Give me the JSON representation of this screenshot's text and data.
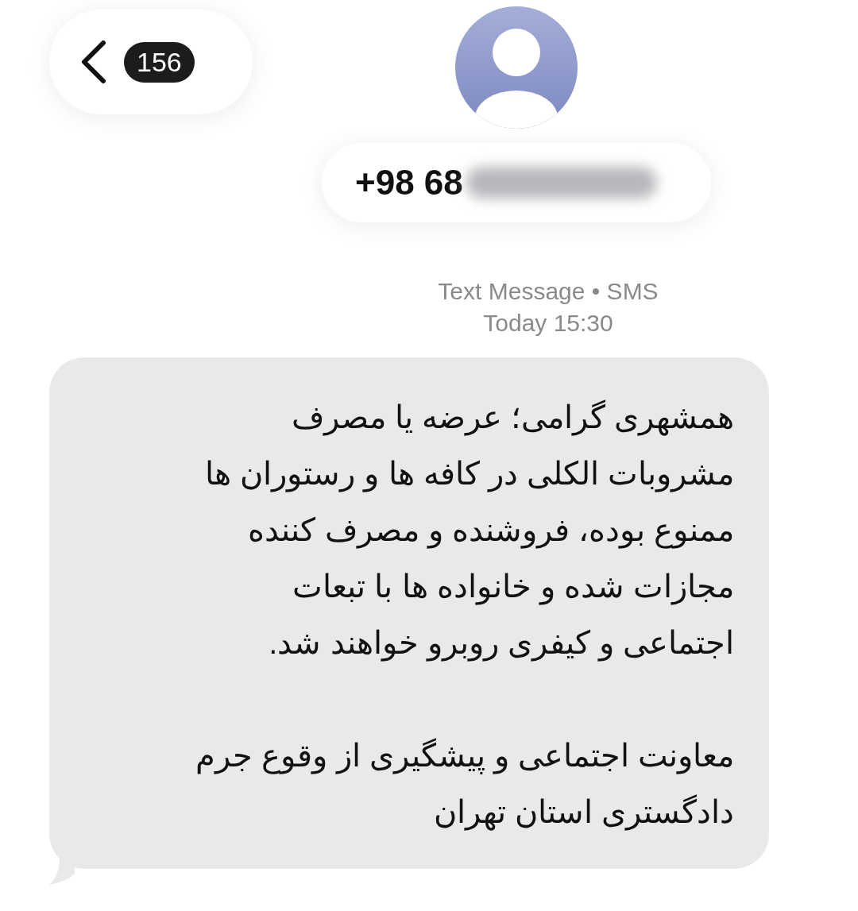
{
  "header": {
    "unread_count": "156",
    "sender": "+98 68"
  },
  "meta": {
    "service": "Text Message • SMS",
    "time": "Today 15:30"
  },
  "message": {
    "paragraphs": [
      "همشهری گرامی؛ عرضه یا مصرف\nمشروبات الکلی در کافه ها و رستوران ها\nممنوع بوده، فروشنده و مصرف کننده\nمجازات شده و خانواده ها با تبعات\nاجتماعی و کیفری روبرو خواهند شد.",
      "معاونت اجتماعی و پیشگیری از وقوع جرم\nدادگستری استان تهران"
    ]
  }
}
